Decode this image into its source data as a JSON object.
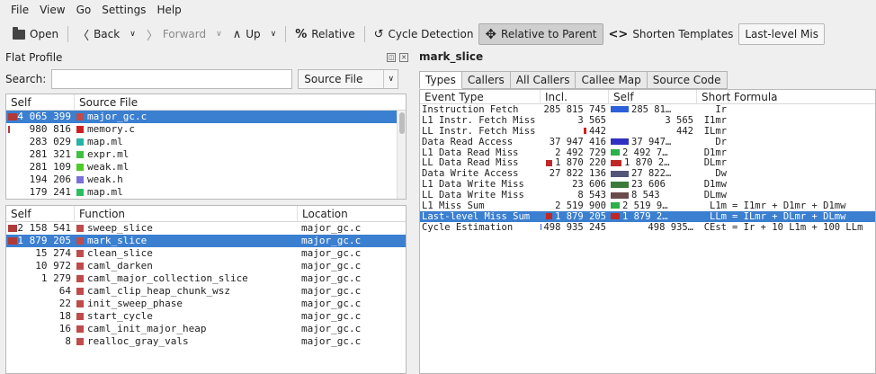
{
  "menu": [
    "File",
    "View",
    "Go",
    "Settings",
    "Help"
  ],
  "toolbar": {
    "open": "Open",
    "back": "Back",
    "forward": "Forward",
    "up": "Up",
    "relative": "Relative",
    "cycle_detection": "Cycle Detection",
    "relative_to_parent": "Relative to Parent",
    "shorten_templates": "Shorten Templates",
    "event_select": "Last-level Mis"
  },
  "flat_profile": {
    "title": "Flat Profile",
    "search_label": "Search:",
    "search_value": "",
    "grouping": "Source File",
    "file_headers": [
      "Self",
      "Source File"
    ],
    "files": [
      {
        "self": "4 065 399",
        "name": "major_gc.c",
        "color": "#b03a3a",
        "sq": "#c04b4b",
        "bar": 1.0,
        "selected": true
      },
      {
        "self": "980 816",
        "name": "memory.c",
        "color": "#b03a3a",
        "sq": "#cc2020",
        "bar": 0.15,
        "selected": false
      },
      {
        "self": "283 029",
        "name": "map.ml",
        "color": "#26b3a8",
        "sq": "#26b3a8",
        "bar": 0,
        "selected": false
      },
      {
        "self": "281 321",
        "name": "expr.ml",
        "color": "#40c040",
        "sq": "#40c040",
        "bar": 0,
        "selected": false
      },
      {
        "self": "281 109",
        "name": "weak.ml",
        "color": "#4ecb28",
        "sq": "#4ecb28",
        "bar": 0,
        "selected": false
      },
      {
        "self": "194 206",
        "name": "weak.h",
        "color": "#7a70d8",
        "sq": "#7a70d8",
        "bar": 0,
        "selected": false
      },
      {
        "self": "179 241",
        "name": "map.ml",
        "color": "#2cbf60",
        "sq": "#2cbf60",
        "bar": 0,
        "selected": false
      }
    ],
    "func_headers": [
      "Self",
      "Function",
      "Location"
    ],
    "functions": [
      {
        "self": "2 158 541",
        "name": "sweep_slice",
        "loc": "major_gc.c",
        "bar": 1.0,
        "selected": false
      },
      {
        "self": "1 879 205",
        "name": "mark_slice",
        "loc": "major_gc.c",
        "bar": 0.85,
        "selected": true
      },
      {
        "self": "15 274",
        "name": "clean_slice",
        "loc": "major_gc.c",
        "bar": 0,
        "selected": false
      },
      {
        "self": "10 972",
        "name": "caml_darken",
        "loc": "major_gc.c",
        "bar": 0,
        "selected": false
      },
      {
        "self": "1 279",
        "name": "caml_major_collection_slice",
        "loc": "major_gc.c",
        "bar": 0,
        "selected": false
      },
      {
        "self": "64",
        "name": "caml_clip_heap_chunk_wsz",
        "loc": "major_gc.c",
        "bar": 0,
        "selected": false
      },
      {
        "self": "22",
        "name": "init_sweep_phase",
        "loc": "major_gc.c",
        "bar": 0,
        "selected": false
      },
      {
        "self": "18",
        "name": "start_cycle",
        "loc": "major_gc.c",
        "bar": 0,
        "selected": false
      },
      {
        "self": "16",
        "name": "caml_init_major_heap",
        "loc": "major_gc.c",
        "bar": 0,
        "selected": false
      },
      {
        "self": "8",
        "name": "realloc_gray_vals",
        "loc": "major_gc.c",
        "bar": 0,
        "selected": false
      }
    ]
  },
  "detail": {
    "title": "mark_slice",
    "tabs": [
      "Types",
      "Callers",
      "All Callers",
      "Callee Map",
      "Source Code"
    ],
    "headers": [
      "Event Type",
      "Incl.",
      "Self",
      "Short",
      "Formula"
    ],
    "events": [
      {
        "type": "Instruction Fetch",
        "incl": "285 815 745",
        "self": "285 81…",
        "short": "Ir",
        "formula": "",
        "color": "#2d5fd8",
        "ibar": 0,
        "sbar": 1.0,
        "selected": false
      },
      {
        "type": "L1 Instr. Fetch Miss",
        "incl": "3 565",
        "self": "3 565",
        "short": "I1mr",
        "formula": "",
        "color": "#888",
        "ibar": 0,
        "sbar": 0,
        "selected": false
      },
      {
        "type": "LL Instr. Fetch Miss",
        "incl": "442",
        "self": "442",
        "short": "ILmr",
        "formula": "",
        "color": "#d02020",
        "ibar": 0.15,
        "sbar": 0,
        "selected": false
      },
      {
        "type": "Data Read Access",
        "incl": "37 947 416",
        "self": "37 947…",
        "short": "Dr",
        "formula": "",
        "color": "#3030c0",
        "ibar": 0,
        "sbar": 1.0,
        "selected": false
      },
      {
        "type": "L1 Data Read Miss",
        "incl": "2 492 729",
        "self": "2 492 7…",
        "short": "D1mr",
        "formula": "",
        "color": "#2cb04a",
        "ibar": 0,
        "sbar": 0.5,
        "selected": false
      },
      {
        "type": "LL Data Read Miss",
        "incl": "1 870 220",
        "self": "1 870 2…",
        "short": "DLmr",
        "formula": "",
        "color": "#c02828",
        "ibar": 0.3,
        "sbar": 0.6,
        "selected": false
      },
      {
        "type": "Data Write Access",
        "incl": "27 822 136",
        "self": "27 822…",
        "short": "Dw",
        "formula": "",
        "color": "#555577",
        "ibar": 0,
        "sbar": 1.0,
        "selected": false
      },
      {
        "type": "L1 Data Write Miss",
        "incl": "23 606",
        "self": "23 606",
        "short": "D1mw",
        "formula": "",
        "color": "#3a7a3a",
        "ibar": 0,
        "sbar": 1.0,
        "selected": false
      },
      {
        "type": "LL Data Write Miss",
        "incl": "8 543",
        "self": "8 543",
        "short": "DLmw",
        "formula": "",
        "color": "#6a4a4a",
        "ibar": 0,
        "sbar": 1.0,
        "selected": false
      },
      {
        "type": "L1 Miss Sum",
        "incl": "2 519 900",
        "self": "2 519 9…",
        "short": "L1m",
        "formula": "= I1mr + D1mr + D1mw",
        "color": "#2cb04a",
        "ibar": 0,
        "sbar": 0.5,
        "selected": false
      },
      {
        "type": "Last-level Miss Sum",
        "incl": "1 879 205",
        "self": "1 879 2…",
        "short": "LLm",
        "formula": "= ILmr + DLmr + DLmw",
        "color": "#c02828",
        "ibar": 0.3,
        "sbar": 0.5,
        "selected": true
      },
      {
        "type": "Cycle Estimation",
        "incl": "498 935 245",
        "self": "498 935…",
        "short": "CEst",
        "formula": "= Ir + 10 L1m + 100 LLm",
        "color": "#2d5fd8",
        "ibar": 0.4,
        "sbar": 0,
        "selected": false
      }
    ]
  }
}
